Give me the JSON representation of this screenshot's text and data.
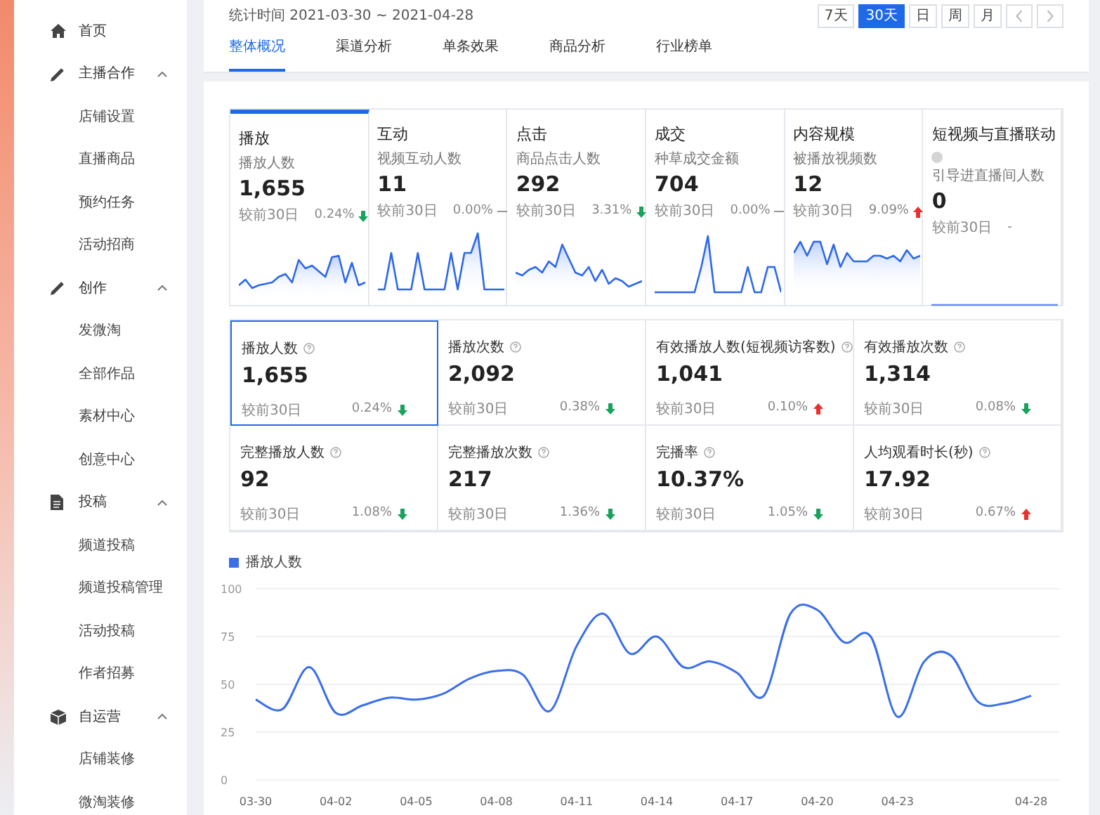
{
  "sidebar": {
    "items": [
      {
        "label": "首页"
      },
      {
        "label": "主播合作",
        "expanded": true,
        "children": [
          {
            "label": "店铺设置"
          },
          {
            "label": "直播商品"
          },
          {
            "label": "预约任务"
          },
          {
            "label": "活动招商"
          }
        ]
      },
      {
        "label": "创作",
        "expanded": true,
        "children": [
          {
            "label": "发微淘"
          },
          {
            "label": "全部作品"
          },
          {
            "label": "素材中心"
          },
          {
            "label": "创意中心"
          }
        ]
      },
      {
        "label": "投稿",
        "expanded": true,
        "children": [
          {
            "label": "频道投稿"
          },
          {
            "label": "频道投稿管理"
          },
          {
            "label": "活动投稿"
          },
          {
            "label": "作者招募"
          }
        ]
      },
      {
        "label": "自运营",
        "expanded": true,
        "children": [
          {
            "label": "店铺装修"
          },
          {
            "label": "微淘装修"
          }
        ]
      }
    ]
  },
  "header": {
    "date_range": "统计时间 2021-03-30 ~ 2021-04-28",
    "period_buttons": [
      {
        "label": "7天",
        "selected": false
      },
      {
        "label": "30天",
        "selected": true
      },
      {
        "label": "日",
        "selected": false
      },
      {
        "label": "周",
        "selected": false
      },
      {
        "label": "月",
        "selected": false
      }
    ]
  },
  "tabs": [
    {
      "label": "整体概况",
      "selected": true
    },
    {
      "label": "渠道分析",
      "selected": false
    },
    {
      "label": "单条效果",
      "selected": false
    },
    {
      "label": "商品分析",
      "selected": false
    },
    {
      "label": "行业榜单",
      "selected": false
    }
  ],
  "overview_cards": [
    {
      "title": "播放",
      "metric": "播放人数",
      "value": "1,655",
      "compare": "较前30日",
      "change": {
        "text": "0.24%",
        "kind": "down"
      },
      "selected": true
    },
    {
      "title": "互动",
      "metric": "视频互动人数",
      "value": "11",
      "compare": "较前30日",
      "change": {
        "text": "0.00%",
        "kind": "flat"
      },
      "selected": false
    },
    {
      "title": "点击",
      "metric": "商品点击人数",
      "value": "292",
      "compare": "较前30日",
      "change": {
        "text": "3.31%",
        "kind": "down"
      },
      "selected": false
    },
    {
      "title": "成交",
      "metric": "种草成交金额",
      "value": "704",
      "compare": "较前30日",
      "change": {
        "text": "0.00%",
        "kind": "flat"
      },
      "selected": false
    },
    {
      "title": "内容规模",
      "metric": "被播放视频数",
      "value": "12",
      "compare": "较前30日",
      "change": {
        "text": "9.09%",
        "kind": "up"
      },
      "selected": false
    },
    {
      "title": "短视频与直播联动",
      "metric": "引导进直播间人数",
      "value": "0",
      "compare": "较前30日",
      "change": {
        "text": "-",
        "kind": "none"
      },
      "selected": false
    }
  ],
  "metrics": [
    {
      "label": "播放人数",
      "value": "1,655",
      "compare": "较前30日",
      "change": {
        "text": "0.24%",
        "kind": "down"
      },
      "selected": true
    },
    {
      "label": "播放次数",
      "value": "2,092",
      "compare": "较前30日",
      "change": {
        "text": "0.38%",
        "kind": "down"
      },
      "selected": false
    },
    {
      "label": "有效播放人数(短视频访客数)",
      "value": "1,041",
      "compare": "较前30日",
      "change": {
        "text": "0.10%",
        "kind": "up"
      },
      "selected": false
    },
    {
      "label": "有效播放次数",
      "value": "1,314",
      "compare": "较前30日",
      "change": {
        "text": "0.08%",
        "kind": "down"
      },
      "selected": false
    },
    {
      "label": "完整播放人数",
      "value": "92",
      "compare": "较前30日",
      "change": {
        "text": "1.08%",
        "kind": "down"
      },
      "selected": false
    },
    {
      "label": "完整播放次数",
      "value": "217",
      "compare": "较前30日",
      "change": {
        "text": "1.36%",
        "kind": "down"
      },
      "selected": false
    },
    {
      "label": "完播率",
      "value": "10.37%",
      "compare": "较前30日",
      "change": {
        "text": "1.05%",
        "kind": "down"
      },
      "selected": false
    },
    {
      "label": "人均观看时长(秒)",
      "value": "17.92",
      "compare": "较前30日",
      "change": {
        "text": "0.67%",
        "kind": "up"
      },
      "selected": false
    }
  ],
  "trend_chart": {
    "chart_data": {
      "type": "line",
      "categories": [
        "03-30",
        null,
        null,
        "04-02",
        null,
        null,
        "04-05",
        null,
        null,
        "04-08",
        null,
        null,
        "04-11",
        null,
        null,
        "04-14",
        null,
        null,
        "04-17",
        null,
        null,
        "04-20",
        null,
        null,
        "04-23",
        null,
        null,
        null,
        null,
        "04-28"
      ],
      "series": [
        {
          "name": "播放人数",
          "color": "#3b6fe8",
          "values": [
            42,
            37,
            59,
            35,
            39,
            43,
            42,
            45,
            53,
            57,
            55,
            36,
            70,
            87,
            66,
            75,
            59,
            62,
            56,
            44,
            87,
            89,
            72,
            75,
            33,
            62,
            65,
            41,
            40,
            44
          ]
        }
      ],
      "ylim": [
        0,
        100
      ],
      "yticks": [
        0,
        25,
        50,
        75,
        100
      ],
      "grid": true
    }
  }
}
